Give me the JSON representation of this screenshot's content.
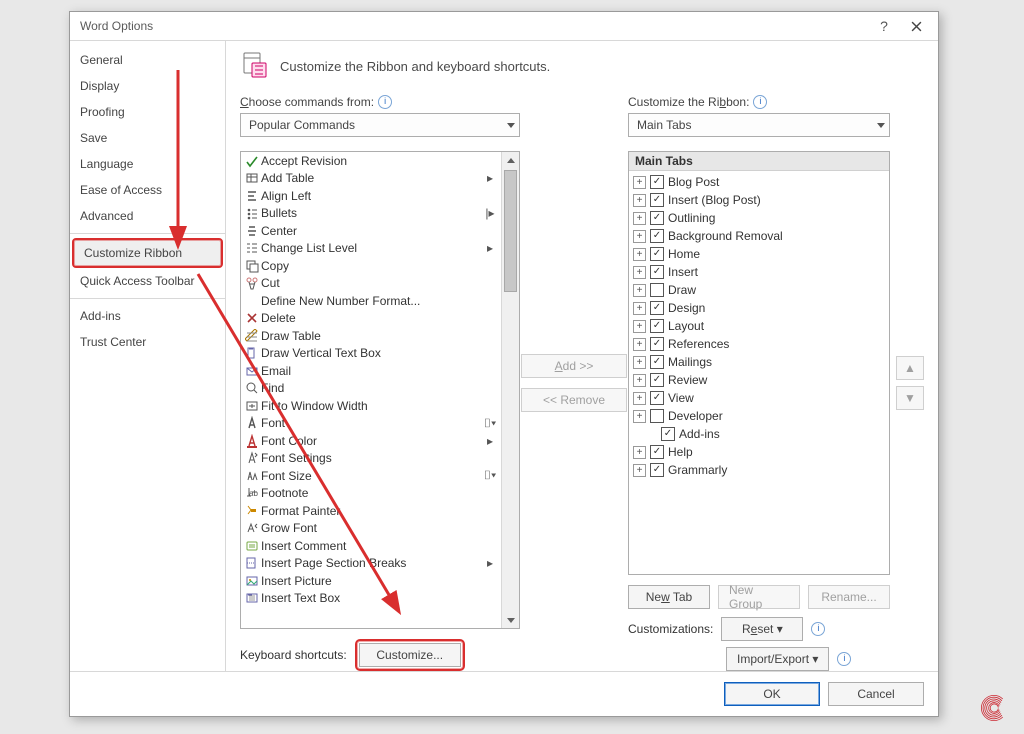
{
  "dialog": {
    "title": "Word Options",
    "help_tooltip": "?",
    "close_tooltip": "Close"
  },
  "sidebar": {
    "items": [
      {
        "label": "General"
      },
      {
        "label": "Display"
      },
      {
        "label": "Proofing"
      },
      {
        "label": "Save"
      },
      {
        "label": "Language"
      },
      {
        "label": "Ease of Access"
      },
      {
        "label": "Advanced"
      }
    ],
    "items2": [
      {
        "label": "Customize Ribbon",
        "selected": true
      },
      {
        "label": "Quick Access Toolbar"
      }
    ],
    "items3": [
      {
        "label": "Add-ins"
      },
      {
        "label": "Trust Center"
      }
    ]
  },
  "header": {
    "text": "Customize the Ribbon and keyboard shortcuts."
  },
  "left": {
    "choose_label": "Choose commands from:",
    "choose_info": "i",
    "choose_value": "Popular Commands",
    "commands": [
      {
        "label": "Accept Revision",
        "sub": ""
      },
      {
        "label": "Add Table",
        "sub": "▸"
      },
      {
        "label": "Align Left",
        "sub": ""
      },
      {
        "label": "Bullets",
        "sub": "|▸"
      },
      {
        "label": "Center",
        "sub": ""
      },
      {
        "label": "Change List Level",
        "sub": "▸"
      },
      {
        "label": "Copy",
        "sub": ""
      },
      {
        "label": "Cut",
        "sub": ""
      },
      {
        "label": "Define New Number Format...",
        "sub": ""
      },
      {
        "label": "Delete",
        "sub": ""
      },
      {
        "label": "Draw Table",
        "sub": ""
      },
      {
        "label": "Draw Vertical Text Box",
        "sub": ""
      },
      {
        "label": "Email",
        "sub": ""
      },
      {
        "label": "Find",
        "sub": ""
      },
      {
        "label": "Fit to Window Width",
        "sub": ""
      },
      {
        "label": "Font",
        "sub": "⌷▾"
      },
      {
        "label": "Font Color",
        "sub": "▸"
      },
      {
        "label": "Font Settings",
        "sub": ""
      },
      {
        "label": "Font Size",
        "sub": "⌷▾"
      },
      {
        "label": "Footnote",
        "sub": ""
      },
      {
        "label": "Format Painter",
        "sub": ""
      },
      {
        "label": "Grow Font",
        "sub": ""
      },
      {
        "label": "Insert Comment",
        "sub": ""
      },
      {
        "label": "Insert Page  Section Breaks",
        "sub": "▸"
      },
      {
        "label": "Insert Picture",
        "sub": ""
      },
      {
        "label": "Insert Text Box",
        "sub": ""
      }
    ],
    "kb_label": "Keyboard shortcuts:",
    "kb_button": "Customize..."
  },
  "middle": {
    "add_label": "Add >>",
    "remove_label": "<< Remove"
  },
  "right": {
    "custom_label": "Customize the Ribbon:",
    "custom_info": "i",
    "custom_value": "Main Tabs",
    "tree_header": "Main Tabs",
    "tabs": [
      {
        "label": "Blog Post",
        "checked": true
      },
      {
        "label": "Insert (Blog Post)",
        "checked": true
      },
      {
        "label": "Outlining",
        "checked": true
      },
      {
        "label": "Background Removal",
        "checked": true
      },
      {
        "label": "Home",
        "checked": true
      },
      {
        "label": "Insert",
        "checked": true
      },
      {
        "label": "Draw",
        "checked": false
      },
      {
        "label": "Design",
        "checked": true
      },
      {
        "label": "Layout",
        "checked": true
      },
      {
        "label": "References",
        "checked": true
      },
      {
        "label": "Mailings",
        "checked": true
      },
      {
        "label": "Review",
        "checked": true
      },
      {
        "label": "View",
        "checked": true
      },
      {
        "label": "Developer",
        "checked": false
      },
      {
        "label": "Add-ins",
        "checked": true,
        "child": true
      },
      {
        "label": "Help",
        "checked": true
      },
      {
        "label": "Grammarly",
        "checked": true
      }
    ],
    "new_tab": "New Tab",
    "new_group": "New Group",
    "rename": "Rename...",
    "customizations_label": "Customizations:",
    "reset_label": "Reset ▾",
    "import_label": "Import/Export ▾",
    "up_label": "▲",
    "down_label": "▼"
  },
  "footer": {
    "ok": "OK",
    "cancel": "Cancel"
  }
}
